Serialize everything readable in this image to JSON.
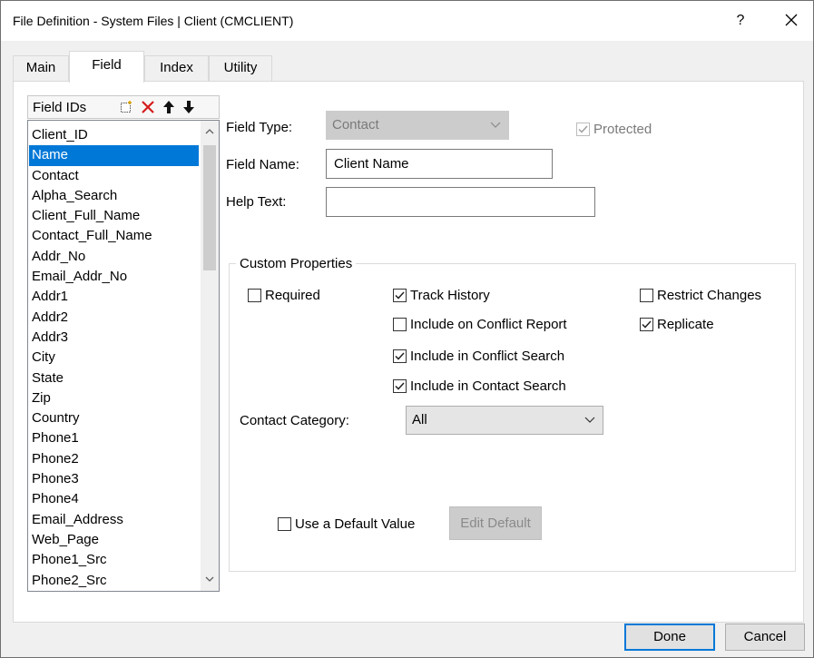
{
  "window": {
    "title": "File Definition - System Files | Client (CMCLIENT)",
    "help_label": "?",
    "close_label": "✕"
  },
  "tabs": [
    {
      "label": "Main",
      "active": false
    },
    {
      "label": "Field",
      "active": true
    },
    {
      "label": "Index",
      "active": false
    },
    {
      "label": "Utility",
      "active": false
    }
  ],
  "field_list": {
    "header": "Field IDs",
    "toolbar": {
      "new_icon": "new-field-icon",
      "delete_icon": "delete-icon",
      "up_icon": "arrow-up-icon",
      "down_icon": "arrow-down-icon"
    },
    "items": [
      "Client_ID",
      "Name",
      "Contact",
      "Alpha_Search",
      "Client_Full_Name",
      "Contact_Full_Name",
      "Addr_No",
      "Email_Addr_No",
      "Addr1",
      "Addr2",
      "Addr3",
      "City",
      "State",
      "Zip",
      "Country",
      "Phone1",
      "Phone2",
      "Phone3",
      "Phone4",
      "Email_Address",
      "Web_Page",
      "Phone1_Src",
      "Phone2_Src"
    ],
    "selected": "Name"
  },
  "form": {
    "field_type_label": "Field Type:",
    "field_type_value": "Contact",
    "protected_label": "Protected",
    "field_name_label": "Field Name:",
    "field_name_value": "Client Name",
    "help_text_label": "Help Text:",
    "help_text_value": ""
  },
  "custom_properties": {
    "title": "Custom Properties",
    "required": {
      "label": "Required",
      "checked": false
    },
    "track_history": {
      "label": "Track History",
      "checked": true
    },
    "restrict_changes": {
      "label": "Restrict Changes",
      "checked": false
    },
    "include_conflict_report": {
      "label": "Include on Conflict Report",
      "checked": false
    },
    "replicate": {
      "label": "Replicate",
      "checked": true
    },
    "include_conflict_search": {
      "label": "Include in Conflict Search",
      "checked": true
    },
    "include_contact_search": {
      "label": "Include in Contact Search",
      "checked": true
    },
    "contact_category_label": "Contact Category:",
    "contact_category_value": "All",
    "use_default_value": {
      "label": "Use a Default Value",
      "checked": false
    },
    "edit_default_label": "Edit Default"
  },
  "footer": {
    "done_label": "Done",
    "cancel_label": "Cancel"
  },
  "colors": {
    "selection": "#0078d7",
    "default_button_border": "#0078d7",
    "delete_icon": "#d41c1c"
  }
}
